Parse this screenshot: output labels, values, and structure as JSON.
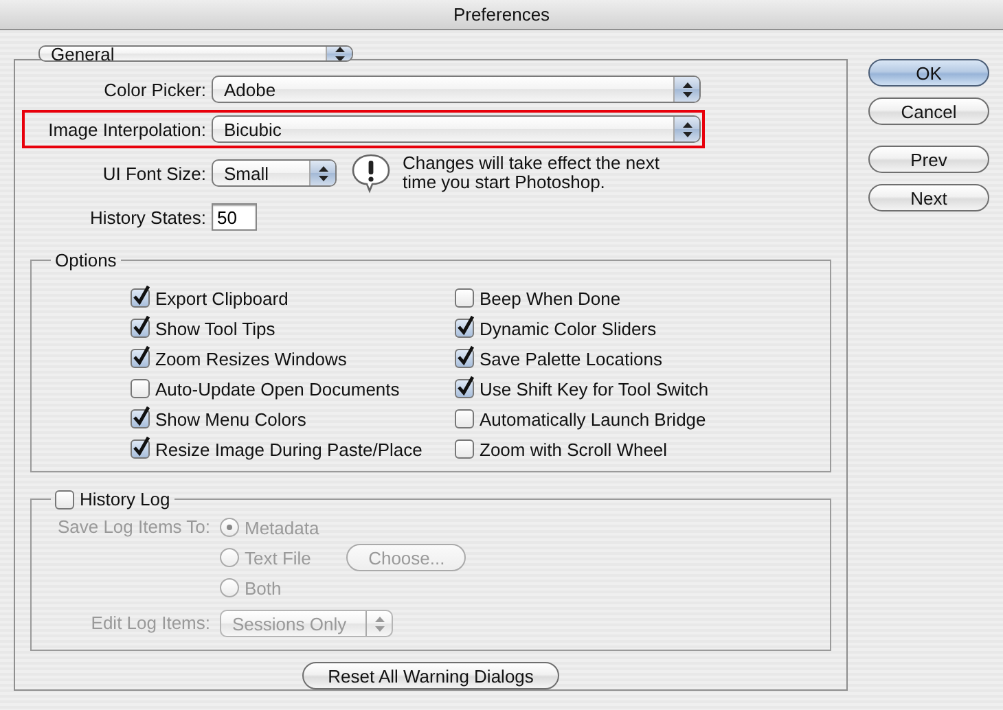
{
  "window": {
    "title": "Preferences"
  },
  "section_menu": {
    "value": "General"
  },
  "fields": [
    {
      "kind": "popup",
      "label": "Color Picker:",
      "value": "Adobe",
      "highlighted": false
    },
    {
      "kind": "popup",
      "label": "Image Interpolation:",
      "value": "Bicubic",
      "highlighted": true
    },
    {
      "kind": "short_popup",
      "label": "UI Font Size:",
      "value": "Small",
      "highlighted": false,
      "note": "Changes will take effect the next time you start Photoshop."
    },
    {
      "kind": "text",
      "label": "History States:",
      "value": "50",
      "highlighted": false
    }
  ],
  "options": {
    "title": "Options",
    "items": [
      {
        "label": "Export Clipboard",
        "checked": true
      },
      {
        "label": "Show Tool Tips",
        "checked": true
      },
      {
        "label": "Zoom Resizes Windows",
        "checked": true
      },
      {
        "label": "Auto-Update Open Documents",
        "checked": false
      },
      {
        "label": "Show Menu Colors",
        "checked": true
      },
      {
        "label": "Resize Image During Paste/Place",
        "checked": true
      },
      {
        "label": "Beep When Done",
        "checked": false
      },
      {
        "label": "Dynamic Color Sliders",
        "checked": true
      },
      {
        "label": "Save Palette Locations",
        "checked": true
      },
      {
        "label": "Use Shift Key for Tool Switch",
        "checked": true
      },
      {
        "label": "Automatically Launch Bridge",
        "checked": false
      },
      {
        "label": "Zoom with Scroll Wheel",
        "checked": false
      }
    ]
  },
  "history_log": {
    "label": "History Log",
    "checked": false,
    "save_to_label": "Save Log Items To:",
    "destinations": [
      {
        "label": "Metadata",
        "selected": true
      },
      {
        "label": "Text File",
        "selected": false
      },
      {
        "label": "Both",
        "selected": false
      }
    ],
    "choose_button": "Choose...",
    "edit_label": "Edit Log Items:",
    "edit_value": "Sessions Only"
  },
  "reset_button": "Reset All Warning Dialogs",
  "buttons": [
    {
      "label": "OK",
      "default": true
    },
    {
      "label": "Cancel",
      "default": false
    },
    {
      "label": "Prev",
      "default": false
    },
    {
      "label": "Next",
      "default": false
    }
  ]
}
